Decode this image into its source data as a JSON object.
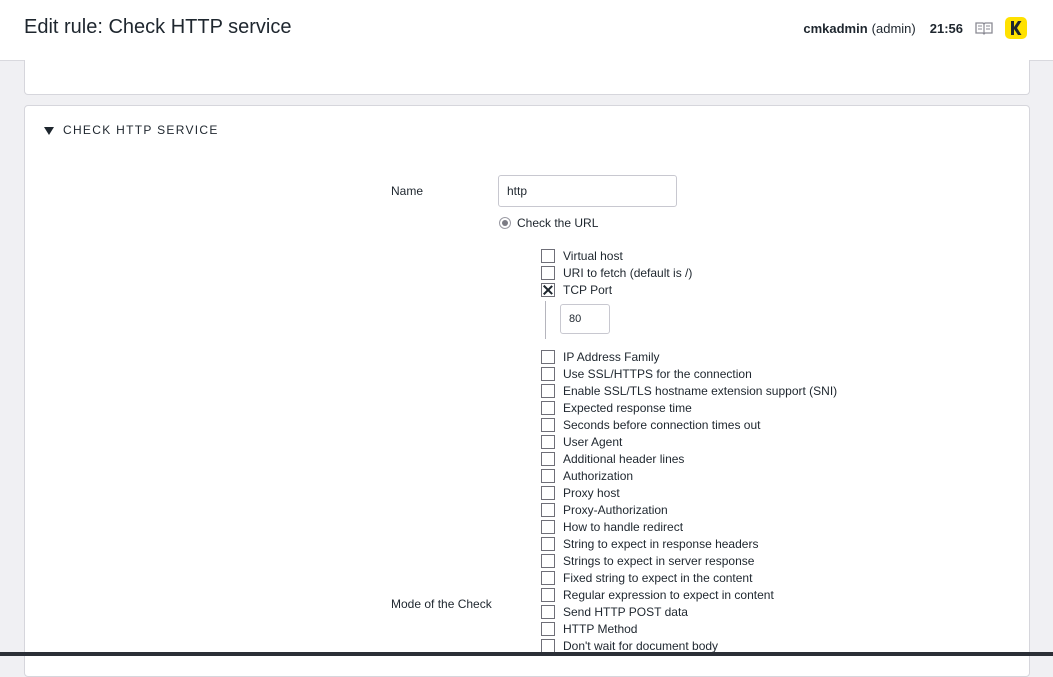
{
  "header": {
    "title": "Edit rule: Check HTTP service",
    "user": "cmkadmin",
    "role": "(admin)",
    "time": "21:56"
  },
  "section": {
    "title": "CHECK HTTP SERVICE"
  },
  "form": {
    "name_label": "Name",
    "name_value": "http",
    "mode_label": "Mode of the Check",
    "radio_label": "Check the URL",
    "tcp_port_value": "80",
    "options": [
      {
        "label": "Virtual host",
        "checked": false
      },
      {
        "label": "URI to fetch (default is /)",
        "checked": false
      },
      {
        "label": "TCP Port",
        "checked": true
      },
      {
        "label": "IP Address Family",
        "checked": false
      },
      {
        "label": "Use SSL/HTTPS for the connection",
        "checked": false
      },
      {
        "label": "Enable SSL/TLS hostname extension support (SNI)",
        "checked": false
      },
      {
        "label": "Expected response time",
        "checked": false
      },
      {
        "label": "Seconds before connection times out",
        "checked": false
      },
      {
        "label": "User Agent",
        "checked": false
      },
      {
        "label": "Additional header lines",
        "checked": false
      },
      {
        "label": "Authorization",
        "checked": false
      },
      {
        "label": "Proxy host",
        "checked": false
      },
      {
        "label": "Proxy-Authorization",
        "checked": false
      },
      {
        "label": "How to handle redirect",
        "checked": false
      },
      {
        "label": "String to expect in response headers",
        "checked": false
      },
      {
        "label": "Strings to expect in server response",
        "checked": false
      },
      {
        "label": "Fixed string to expect in the content",
        "checked": false
      },
      {
        "label": "Regular expression to expect in content",
        "checked": false
      },
      {
        "label": "Send HTTP POST data",
        "checked": false
      },
      {
        "label": "HTTP Method",
        "checked": false
      },
      {
        "label": "Don't wait for document body",
        "checked": false
      }
    ]
  },
  "icons": {
    "book": "book-icon",
    "logo": "checkmk-k-logo-icon"
  },
  "colors": {
    "logo_bg": "#ffe100",
    "background": "#f0f0f3",
    "panel": "#ffffff"
  }
}
